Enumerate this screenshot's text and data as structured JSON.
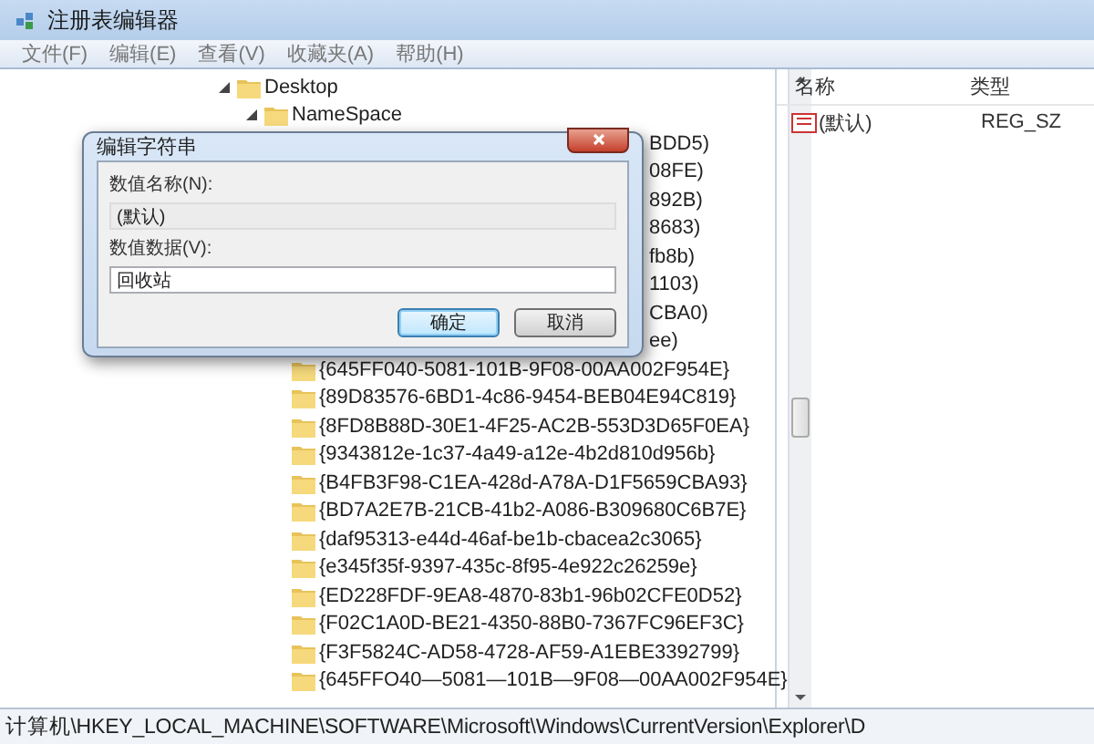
{
  "window": {
    "title": "注册表编辑器"
  },
  "menu": [
    {
      "label": "文件(F)"
    },
    {
      "label": "编辑(E)"
    },
    {
      "label": "查看(V)"
    },
    {
      "label": "收藏夹(A)"
    },
    {
      "label": "帮助(H)"
    }
  ],
  "tree": [
    {
      "label": "Desktop",
      "kind": "folder",
      "expanded": true,
      "children": [
        {
          "label": "NameSpace",
          "kind": "folder",
          "expanded": true,
          "children": [
            {
              "label": "BDD5)",
              "kind": "partial"
            },
            {
              "label": "08FE)",
              "kind": "partial"
            },
            {
              "label": "892B)",
              "kind": "partial"
            },
            {
              "label": "8683)",
              "kind": "partial"
            },
            {
              "label": "fb8b)",
              "kind": "partial"
            },
            {
              "label": "1103)",
              "kind": "partial"
            },
            {
              "label": "CBA0)",
              "kind": "partial"
            },
            {
              "label": "ee)",
              "kind": "partial"
            },
            {
              "label": "{645FF040-5081-101B-9F08-00AA002F954E}",
              "kind": "folder"
            },
            {
              "label": "{89D83576-6BD1-4c86-9454-BEB04E94C819}",
              "kind": "folder"
            },
            {
              "label": "{8FD8B88D-30E1-4F25-AC2B-553D3D65F0EA}",
              "kind": "folder"
            },
            {
              "label": "{9343812e-1c37-4a49-a12e-4b2d810d956b}",
              "kind": "folder"
            },
            {
              "label": "{B4FB3F98-C1EA-428d-A78A-D1F5659CBA93}",
              "kind": "folder"
            },
            {
              "label": "{BD7A2E7B-21CB-41b2-A086-B309680C6B7E}",
              "kind": "folder"
            },
            {
              "label": "{daf95313-e44d-46af-be1b-cbacea2c3065}",
              "kind": "folder"
            },
            {
              "label": "{e345f35f-9397-435c-8f95-4e922c26259e}",
              "kind": "folder"
            },
            {
              "label": "{ED228FDF-9EA8-4870-83b1-96b02CFE0D52}",
              "kind": "folder"
            },
            {
              "label": "{F02C1A0D-BE21-4350-88B0-7367FC96EF3C}",
              "kind": "folder"
            },
            {
              "label": "{F3F5824C-AD58-4728-AF59-A1EBE3392799}",
              "kind": "folder"
            },
            {
              "label": "{645FFO40—5081—101B—9F08—00AA002F954E}",
              "kind": "folder"
            }
          ]
        }
      ]
    }
  ],
  "values_pane": {
    "columns": [
      "名称",
      "类型"
    ],
    "rows": [
      {
        "name": "(默认)",
        "type": "REG_SZ"
      }
    ]
  },
  "dialog": {
    "title": "编辑字符串",
    "name_label": "数值名称(N):",
    "name_value": "(默认)",
    "data_label": "数值数据(V):",
    "data_value": "回收站",
    "buttons": [
      {
        "label": "确定",
        "default": true
      },
      {
        "label": "取消",
        "default": false
      }
    ]
  },
  "status_bar": "计算机\\HKEY_LOCAL_MACHINE\\SOFTWARE\\Microsoft\\Windows\\CurrentVersion\\Explorer\\D"
}
